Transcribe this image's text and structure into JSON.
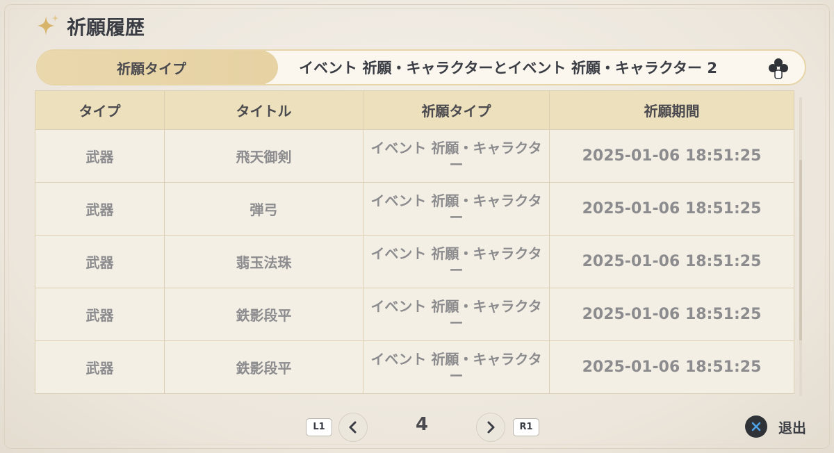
{
  "header": {
    "title": "祈願履歴"
  },
  "filter": {
    "label": "祈願タイプ",
    "value": "イベント 祈願・キャラクターとイベント 祈願・キャラクター 2"
  },
  "table": {
    "headers": [
      "タイプ",
      "タイトル",
      "祈願タイプ",
      "祈願期間"
    ],
    "rows": [
      [
        "武器",
        "飛天御剣",
        "イベント 祈願・キャラクター",
        "2025-01-06 18:51:25"
      ],
      [
        "武器",
        "弾弓",
        "イベント 祈願・キャラクター",
        "2025-01-06 18:51:25"
      ],
      [
        "武器",
        "翡玉法珠",
        "イベント 祈願・キャラクター",
        "2025-01-06 18:51:25"
      ],
      [
        "武器",
        "鉄影段平",
        "イベント 祈願・キャラクター",
        "2025-01-06 18:51:25"
      ],
      [
        "武器",
        "鉄影段平",
        "イベント 祈願・キャラクター",
        "2025-01-06 18:51:25"
      ]
    ]
  },
  "pager": {
    "prev_tag": "L1",
    "next_tag": "R1",
    "page": "4"
  },
  "exit": {
    "label": "退出"
  },
  "icons": {
    "header": "sparkle-icon",
    "filter": "dpad-icon",
    "prev": "chevron-left-icon",
    "next": "chevron-right-icon",
    "exit": "cross-button-icon"
  },
  "colors": {
    "header_row": "#ede0bd",
    "cell_bg": "#f4efe5",
    "cell_text": "#8c8c8f",
    "exit_button": "#2f3237",
    "exit_cross": "#4fa3e8"
  }
}
